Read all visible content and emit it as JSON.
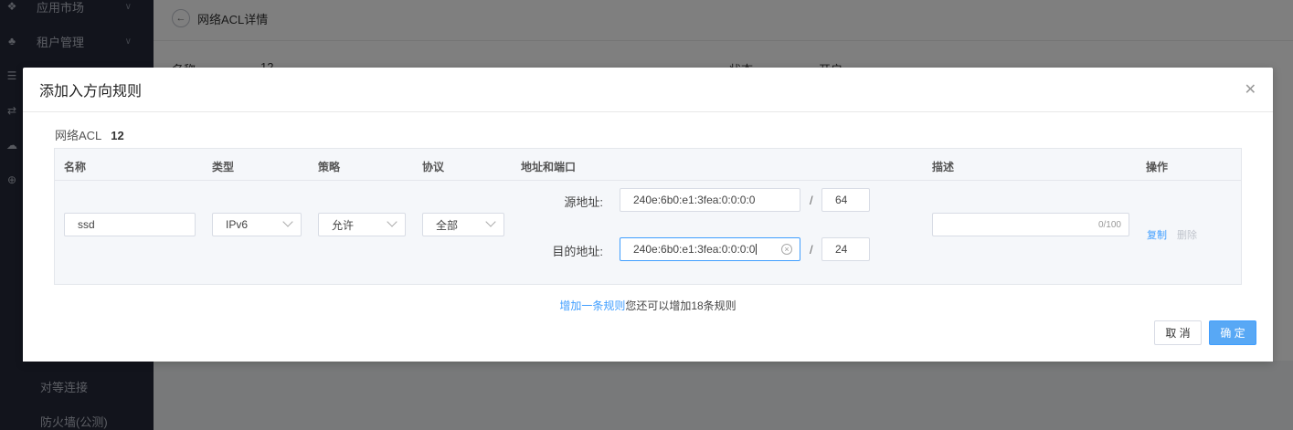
{
  "sidebar": {
    "items": [
      {
        "label": "应用市场",
        "icon": "apps-icon"
      },
      {
        "label": "租户管理",
        "icon": "users-icon"
      }
    ],
    "sub_items": [
      "对等连接",
      "防火墙(公测)"
    ]
  },
  "page": {
    "title": "网络ACL详情",
    "name_label": "名称:",
    "name_value": "12",
    "status_label": "状态:",
    "status_value": "开启"
  },
  "modal": {
    "title": "添加入方向规则",
    "acl_label": "网络ACL",
    "acl_value": "12",
    "columns": [
      "名称",
      "类型",
      "策略",
      "协议",
      "地址和端口",
      "描述",
      "操作"
    ],
    "row": {
      "name": "ssd",
      "type": "IPv6",
      "policy": "允许",
      "protocol": "全部",
      "source_label": "源地址:",
      "source_address": "240e:6b0:e1:3fea:0:0:0:0",
      "source_prefix": "64",
      "dest_label": "目的地址:",
      "dest_address": "240e:6b0:e1:3fea:0:0:0:0",
      "dest_prefix": "24",
      "slash": "/",
      "description": "",
      "description_counter": "0/100",
      "copy_label": "复制",
      "delete_label": "删除"
    },
    "add_rule_link": "增加一条规则",
    "add_rule_tip": "您还可以增加18条规则",
    "cancel_label": "取 消",
    "confirm_label": "确 定",
    "close_icon": "close-icon"
  },
  "colors": {
    "primary": "#409eff",
    "sidebar_bg": "#242938"
  }
}
